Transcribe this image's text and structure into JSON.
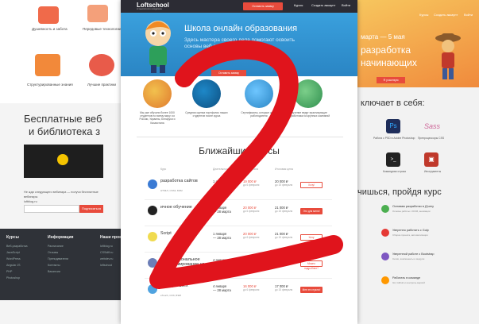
{
  "left_page": {
    "tiles": [
      {
        "label": "Душевность и забота"
      },
      {
        "label": "Передовые технологии"
      },
      {
        "label": "Структурированные знания"
      },
      {
        "label": "Лучшие практики"
      }
    ],
    "heading_line1": "Бесплатные веб",
    "heading_line2": "и библиотека з",
    "signup_text_1": "Не жди следующего вебинара — получи бесплатные",
    "signup_text_2": "вебинары",
    "signup_text_3": "loftblog.ru",
    "signup_button": "Подписаться",
    "footer": {
      "col1_title": "Курсы",
      "col2_title": "Информация",
      "col3_title": "Наши проек",
      "col1_links": [
        "Веб-разработка",
        "JavaScript",
        "WordPress",
        "Angular JS",
        "PHP",
        "Photoshop"
      ],
      "col2_links": [
        "Расписание",
        "Отзывы",
        "Преподаватели",
        "Контакты",
        "Вакансии"
      ],
      "col3_links": [
        "loftblog.ru",
        "CSSdiff.ru",
        "webdev.ru",
        "loftschool"
      ]
    }
  },
  "right_page": {
    "nav_links": [
      "Курсы",
      "Создать аккаунт",
      "Войти"
    ],
    "hero_date": "марта — 5 мая",
    "hero_line1": "разработка",
    "hero_line2": "начинающих",
    "hero_button": "Я участвую",
    "includes_title": "ключает в себя:",
    "tiles": [
      {
        "glyph": "Ps",
        "color": "#1e2d5a",
        "caption": "Работа с PSD в Adobe Photoshop"
      },
      {
        "glyph": "Sass",
        "color": "#ffffff",
        "caption": "Препроцессоры CSS"
      },
      {
        "glyph": ">_",
        "color": "#222222",
        "caption": "Командная строка"
      },
      {
        "glyph": "▣",
        "color": "#c0392b",
        "caption": "Инструменты"
      }
    ],
    "learn_title": "чишься, пройдя курс",
    "items": [
      {
        "title": "Основам разработки в jQuery",
        "sub": "Основы работы с DOM, анимации",
        "color": "#4caf50"
      },
      {
        "title": "Уверенно работать с Gulp",
        "sub": "Сборка проекта, автоматизация",
        "color": "#e53935"
      },
      {
        "title": "Уверенной работе с Bootstrap",
        "sub": "Сетки, компоненты и модули",
        "color": "#7e57c2"
      },
      {
        "title": "Работать в команде",
        "sub": "Git, Github и контроль версий",
        "color": "#ff9800"
      }
    ]
  },
  "center_page": {
    "nav": {
      "logo": "Loftschool",
      "logo_sub": "от мыслителя к создателю",
      "request_button": "Оставить заявку",
      "courses_link": "Курсы",
      "create_account": "Создать аккаунт",
      "login": "Войти"
    },
    "hero": {
      "title": "Школа онлайн образования",
      "subtitle": "Здесь мастера своего дела помогают освоить основы веб-разработки",
      "button": "Оставить заявку"
    },
    "features": [
      {
        "text": "Мы уже обучили более 1000 студентов по всему миру: из России, Украины, Беларуси и Казахстана"
      },
      {
        "text": "Средняя оценка портфолио наших студентов после курса"
      },
      {
        "text": "Сертификаты, которые ценят работодатели"
      },
      {
        "text": "Обучение ведут практикующие разработчики из крупных компаний"
      }
    ],
    "section_title": "Ближайшие курсы",
    "table_headers": [
      "Курс",
      "Длительность",
      "Предоплата",
      "Итоговая цена"
    ],
    "courses": [
      {
        "name": "разработка сайтов",
        "meta": "HTML5, CSS3, БЭМ",
        "start_1": "1 января",
        "start_2": "— 28 марта",
        "disc_1": "19 000 ₽",
        "disc_2": "до 6 февраля",
        "price_1": "20 000 ₽",
        "price_2": "до 15 февраля",
        "button": "Хочу!",
        "filled": false,
        "logo_color": "#3b7bd4"
      },
      {
        "name": "ичное обучение ",
        "meta": "",
        "start_1": "1 января",
        "start_2": "— 28 марта",
        "disc_1": "20 000 ₽",
        "disc_2": "до 6 февраля",
        "price_1": "21 000 ₽",
        "price_2": "до 15 февраля",
        "button": "Это для меня!",
        "filled": true,
        "logo_color": "#222222"
      },
      {
        "name": "Script",
        "meta": "",
        "start_1": "1 января",
        "start_2": "— 28 марта",
        "disc_1": "20 000 ₽",
        "disc_2": "до 6 февраля",
        "price_1": "21 000 ₽",
        "price_2": "до 15 февраля",
        "button": "Хочу",
        "filled": false,
        "logo_color": "#f0db4f"
      },
      {
        "name": "Профессиональное программирование на PHP",
        "meta": "Laravel, MySQL, Kohana",
        "start_1": "4 января",
        "start_2": "— 28 марта",
        "disc_1": "17 000 ₽",
        "disc_2": "до 6 февраля",
        "price_1": "18 000 ₽",
        "price_2": "до 15 февраля",
        "button": "Можно подробнее?",
        "filled": false,
        "logo_color": "#6c7eb7"
      },
      {
        "name": "SEO для всех",
        "meta": "eTouch, СОЗ, БЭМ",
        "start_1": "4 января",
        "start_2": "— 28 марта",
        "disc_1": "16 000 ₽",
        "disc_2": "до 6 февраля",
        "price_1": "17 000 ₽",
        "price_2": "до 15 февраля",
        "button": "Мне это нужно!",
        "filled": true,
        "logo_color": "#4fa3e0"
      }
    ]
  },
  "colors": {
    "accent": "#e84b3c",
    "hero_blue": "#3aa0dd",
    "dark_nav": "#2c2c34",
    "scribble": "#e0141c"
  }
}
